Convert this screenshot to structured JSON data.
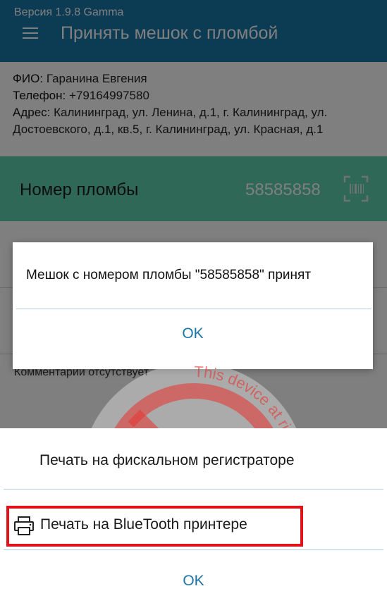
{
  "status_bar": {
    "version": "Версия 1.9.8 Gamma"
  },
  "app_bar": {
    "title": "Принять мешок с пломбой",
    "menu_icon": "hamburger-menu-icon"
  },
  "recipient": {
    "name_label": "ФИО:",
    "name": "Гаранина Евгения",
    "phone_label": "Телефон:",
    "phone": "+79164997580",
    "address_label": "Адрес:",
    "address_line1": "Калининград, ул. Ленина, д.1, г. Калининград, ул.",
    "address_line2": "Достоевского, д.1, кв.5, г. Калининград, ул. Красная, д.1"
  },
  "seal": {
    "label": "Номер пломбы",
    "value": "58585858",
    "scan_icon": "barcode-scan-icon"
  },
  "comment": "Комментарии отсутствует",
  "alert_dialog": {
    "message": "Мешок с номером пломбы \"58585858\" принят",
    "ok_label": "OK"
  },
  "watermark": {
    "text": "This device at risk. Don't deal ! This device at risk. Don't deal !"
  },
  "print_sheet": {
    "fiscal_label": "Печать на фискальном регистраторе",
    "bluetooth_label": "Печать на BlueTooth принтере",
    "bluetooth_icon": "printer-icon",
    "ok_label": "OK"
  },
  "colors": {
    "appbar": "#1976a8",
    "seal_panel": "#5fd0ae",
    "dialog_button": "#1b75a8",
    "highlight": "#e0121a",
    "watermark": "#e8332f"
  }
}
